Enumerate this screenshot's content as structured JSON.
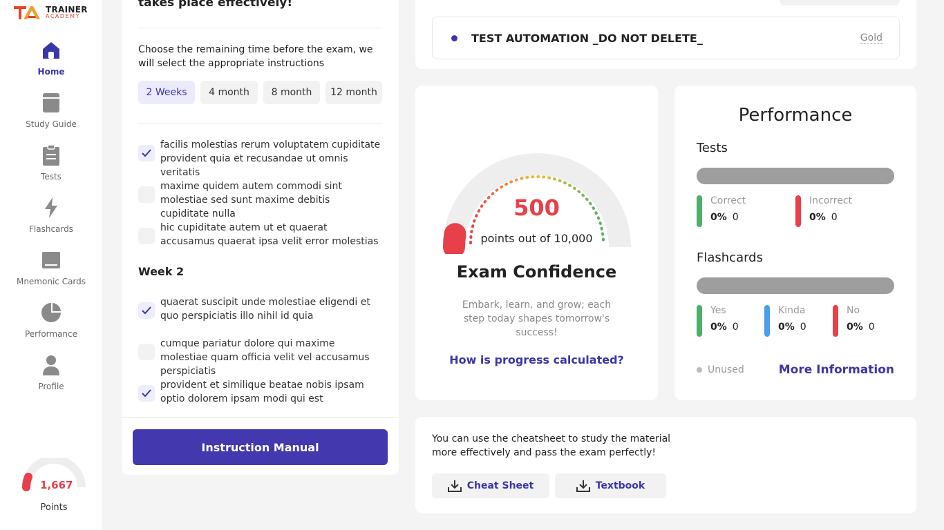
{
  "app": {
    "brand_line1": "TRAINER",
    "brand_line2": "ACADEMY"
  },
  "sidebar": {
    "items": [
      {
        "label": "Home",
        "icon": "home-icon",
        "active": true
      },
      {
        "label": "Study Guide",
        "icon": "book-icon"
      },
      {
        "label": "Tests",
        "icon": "clipboard-icon"
      },
      {
        "label": "Flashcards",
        "icon": "lightning-icon"
      },
      {
        "label": "Mnemonic Cards",
        "icon": "card-icon"
      },
      {
        "label": "Performance",
        "icon": "pie-chart-icon"
      },
      {
        "label": "Profile",
        "icon": "user-icon"
      }
    ],
    "points_value": "1,667",
    "points_label": "Points"
  },
  "plan": {
    "top_title": "takes place effectively!",
    "choose_text": "Choose the remaining time before the exam, we will select the appropriate instructions",
    "periods": [
      "2 Weeks",
      "4 month",
      "8 month",
      "12 month"
    ],
    "selected_period": "2 Weeks",
    "tasks_week1": [
      {
        "text": "facilis molestias rerum voluptatem cupiditate provident quia et recusandae ut omnis veritatis",
        "checked": true
      },
      {
        "text": "maxime quidem autem commodi sint molestiae sed sunt maxime debitis cupiditate nulla",
        "checked": false
      },
      {
        "text": "hic cupiditate autem ut et quaerat accusamus quaerat ipsa velit error molestias",
        "checked": false
      }
    ],
    "week2_title": "Week 2",
    "tasks_week2": [
      {
        "text": "quaerat suscipit unde molestiae eligendi et quo perspiciatis illo nihil id quia",
        "checked": true
      },
      {
        "text": "cumque pariatur dolore qui maxime molestiae quam officia velit vel accusamus perspiciatis",
        "checked": false
      },
      {
        "text": "provident et similique beatae nobis ipsam optio dolorem ipsam modi qui est",
        "checked": true
      }
    ],
    "manual_button": "Instruction Manual"
  },
  "exam": {
    "name": "TEST AUTOMATION _DO NOT DELETE_",
    "tier": "Gold"
  },
  "confidence": {
    "score": "500",
    "subtitle": "points out of 10,000",
    "title": "Exam Confidence",
    "description": "Embark, learn, and grow; each step today shapes tomorrow's success!",
    "link": "How is progress calculated?",
    "fraction": 0.05
  },
  "performance": {
    "title": "Performance",
    "tests_label": "Tests",
    "tests_stats": [
      {
        "name": "Correct",
        "pct": "0%",
        "count": "0",
        "color": "#4caf6a"
      },
      {
        "name": "Incorrect",
        "pct": "0%",
        "count": "0",
        "color": "#e8404a"
      }
    ],
    "flashcards_label": "Flashcards",
    "flashcard_stats": [
      {
        "name": "Yes",
        "pct": "0%",
        "count": "0",
        "color": "#4caf6a"
      },
      {
        "name": "Kinda",
        "pct": "0%",
        "count": "0",
        "color": "#4a9fe8"
      },
      {
        "name": "No",
        "pct": "0%",
        "count": "0",
        "color": "#e8404a"
      }
    ],
    "unused_label": "Unused",
    "more_info": "More Information"
  },
  "cheat": {
    "text": "You can use the cheatsheet to study the material more effectively and pass the exam perfectly!",
    "cheat_button": "Cheat Sheet",
    "textbook_button": "Textbook"
  },
  "colors": {
    "accent": "#3b36a8",
    "button": "#4438ae",
    "danger": "#e8404a"
  }
}
